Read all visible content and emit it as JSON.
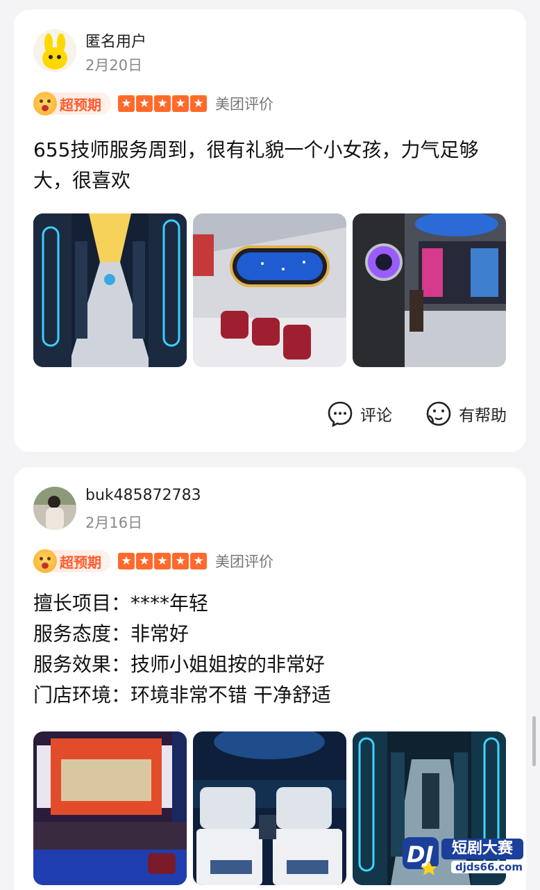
{
  "reviews": [
    {
      "username": "匿名用户",
      "date": "2月20日",
      "badge": "超预期",
      "stars": 5,
      "source": "美团评价",
      "text_lines": [
        "655技师服务周到，很有礼貌一个小女孩，力气足够",
        "大，很喜欢"
      ],
      "photos": [
        "corridor-photo",
        "lounge-photo",
        "lobby-photo"
      ],
      "actions": {
        "comment": "评论",
        "helpful": "有帮助"
      }
    },
    {
      "username": "buk485872783",
      "date": "2月16日",
      "badge": "超预期",
      "stars": 5,
      "source": "美团评价",
      "text_lines": [
        "擅长项目：****年轻",
        "服务态度：非常好",
        "服务效果：技师小姐姐按的非常好",
        "门店环境：环境非常不错 干净舒适"
      ],
      "photos": [
        "reception-photo",
        "massage-beds-photo",
        "corridor-photo"
      ]
    }
  ],
  "watermark": {
    "brand": "短剧大赛",
    "url": "djds66.com"
  },
  "colors": {
    "accent": "#ff6a2c",
    "badge_text": "#ff5a2c",
    "card": "#ffffff",
    "background": "#f4f4f6"
  }
}
